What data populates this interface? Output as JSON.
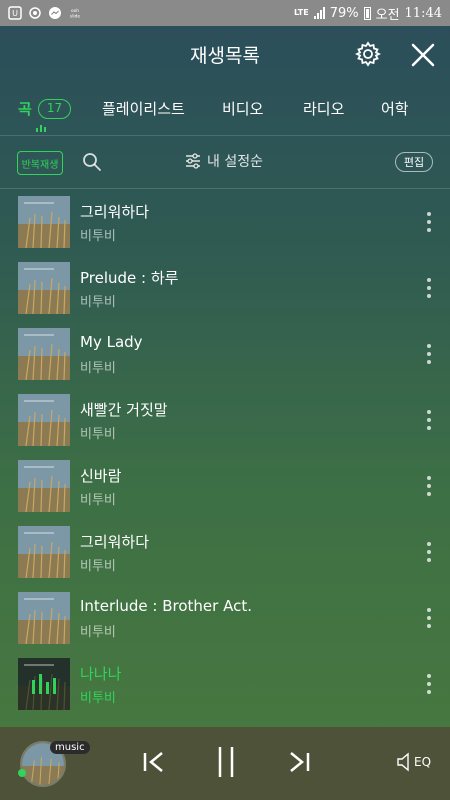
{
  "status_bar": {
    "battery": "79%",
    "network": "LTE",
    "ampm": "오전",
    "time": "11:44"
  },
  "header": {
    "title": "재생목록"
  },
  "tabs": [
    {
      "label": "곡",
      "count": "17",
      "active": true
    },
    {
      "label": "플레이리스트"
    },
    {
      "label": "비디오"
    },
    {
      "label": "라디오"
    },
    {
      "label": "어학"
    }
  ],
  "tools": {
    "repeat_label": "반복재생",
    "sort_label": "내 설정순",
    "edit_label": "편집"
  },
  "songs": [
    {
      "title": "그리워하다",
      "artist": "비투비"
    },
    {
      "title": "Prelude : 하루",
      "artist": "비투비"
    },
    {
      "title": "My Lady",
      "artist": "비투비"
    },
    {
      "title": "새빨간 거짓말",
      "artist": "비투비"
    },
    {
      "title": "신바람",
      "artist": "비투비"
    },
    {
      "title": "그리워하다",
      "artist": "비투비"
    },
    {
      "title": "Interlude : Brother Act.",
      "artist": "비투비"
    },
    {
      "title": "나나나",
      "artist": "비투비",
      "playing": true
    }
  ],
  "player": {
    "badge": "music",
    "eq_label": "EQ"
  },
  "colors": {
    "accent": "#31d35b",
    "status_bar": "#8a8a8a"
  }
}
